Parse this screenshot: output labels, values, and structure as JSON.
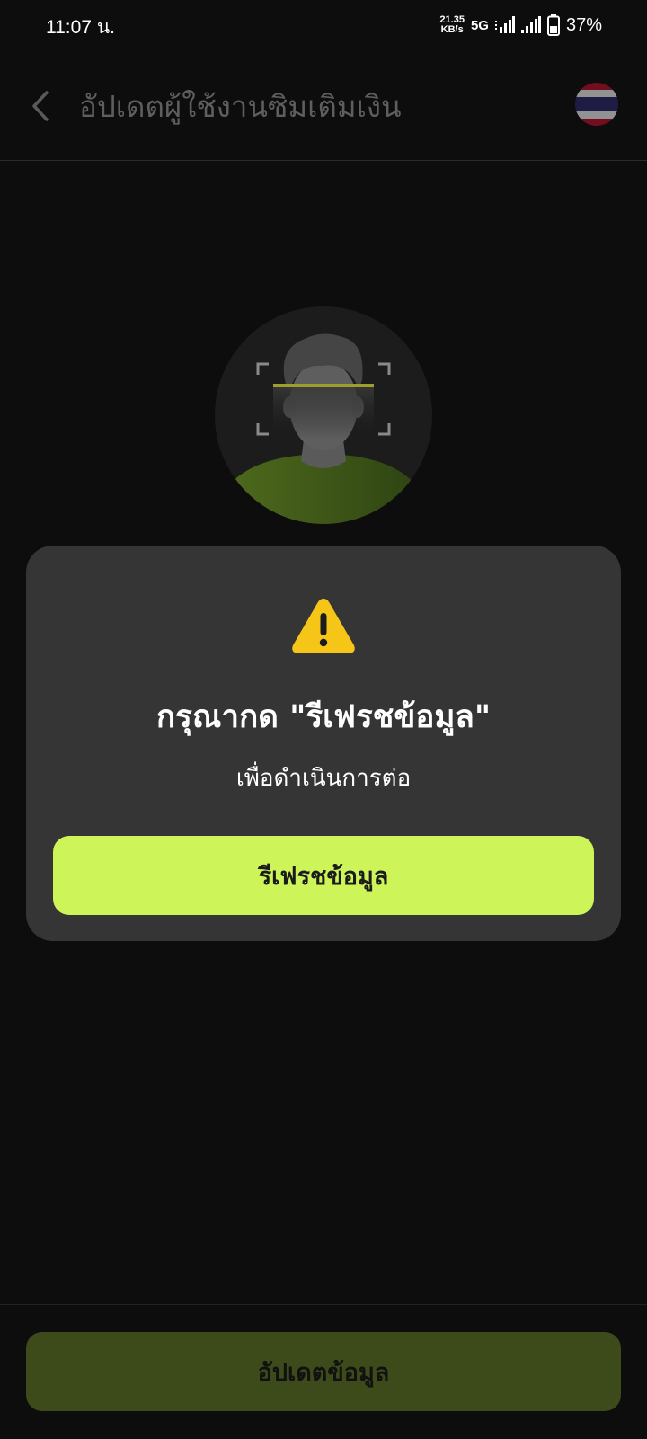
{
  "status_bar": {
    "time": "11:07 น.",
    "net_speed_value": "21.35",
    "net_speed_unit": "KB/s",
    "network_type": "5G",
    "battery": "37%"
  },
  "header": {
    "title": "อัปเดตผู้ใช้งานซิมเติมเงิน",
    "back_icon": "chevron-left-icon",
    "flag_icon": "thailand-flag-icon"
  },
  "dialog": {
    "icon": "warning-icon",
    "title": "กรุณากด \"รีเฟรชข้อมูล\"",
    "message": "เพื่อดำเนินการต่อ",
    "button_label": "รีเฟรชข้อมูล"
  },
  "footer": {
    "button_label": "อัปเดตข้อมูล"
  },
  "colors": {
    "accent": "#cdf55a",
    "accent_dim": "#3d4a1a",
    "dialog_bg": "#353535",
    "page_bg": "#0d0d0d",
    "warning": "#f5c518"
  }
}
